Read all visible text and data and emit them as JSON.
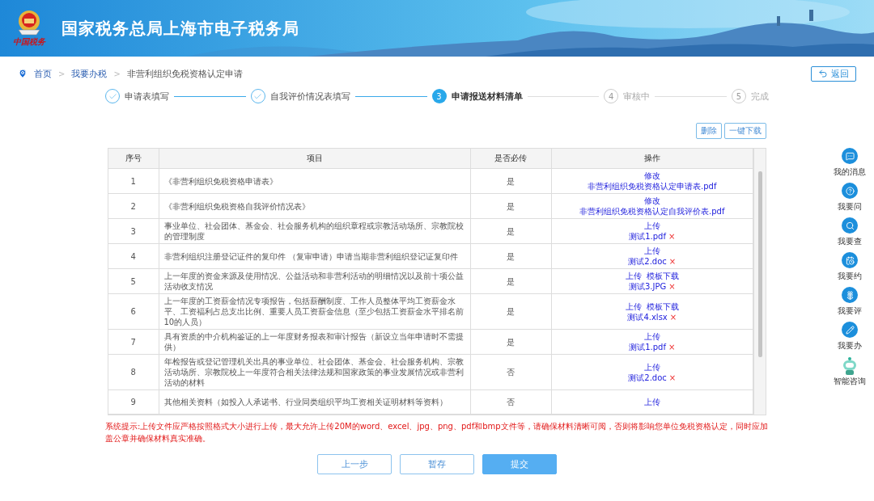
{
  "header": {
    "title": "国家税务总局上海市电子税务局",
    "logo_text": "中国税务"
  },
  "breadcrumb": [
    {
      "label": "首页",
      "kind": "link"
    },
    {
      "label": "我要办税",
      "kind": "link"
    },
    {
      "label": "非营利组织免税资格认定申请",
      "kind": "current"
    }
  ],
  "breadcrumb_separator": ">",
  "back_button": "返回",
  "steps": [
    {
      "label": "申请表填写",
      "completed": true,
      "selected": false
    },
    {
      "label": "自我评价情况表填写",
      "completed": true,
      "selected": false
    },
    {
      "number": "3",
      "label": "申请报送材料清单",
      "completed": false,
      "selected": true
    },
    {
      "number": "4",
      "label": "审核中",
      "completed": false,
      "selected": false
    },
    {
      "number": "5",
      "label": "完成",
      "completed": false,
      "selected": false
    }
  ],
  "toolbar": [
    "删除",
    "一键下载"
  ],
  "table": {
    "columns": [
      "序号",
      "项目",
      "是否必传",
      "操作"
    ],
    "rows": [
      {
        "seq": "1",
        "item": "《非营利组织免税资格申请表》",
        "required": "是",
        "actions": [
          "修改"
        ],
        "file": {
          "name": "非营利组织免税资格认定申请表.pdf"
        }
      },
      {
        "seq": "2",
        "item": "《非营利组织免税资格自我评价情况表》",
        "required": "是",
        "actions": [
          "修改"
        ],
        "file": {
          "name": "非营利组织免税资格认定自我评价表.pdf"
        }
      },
      {
        "seq": "3",
        "item": "事业单位、社会团体、基金会、社会服务机构的组织章程或宗教活动场所、宗教院校的管理制度",
        "required": "是",
        "actions": [
          "上传"
        ],
        "file": {
          "name": "测试1.pdf",
          "remove": "×"
        }
      },
      {
        "seq": "4",
        "item": "非营利组织注册登记证件的复印件 （复审申请）申请当期非营利组织登记证复印件",
        "required": "是",
        "actions": [
          "上传"
        ],
        "file": {
          "name": "测试2.doc",
          "remove": "×"
        }
      },
      {
        "seq": "5",
        "item": "上一年度的资金来源及使用情况、公益活动和非营利活动的明细情况以及前十项公益活动收支情况",
        "required": "是",
        "actions": [
          "上传",
          "模板下载"
        ],
        "file": {
          "name": "测试3.JPG",
          "remove": "×"
        }
      },
      {
        "seq": "6",
        "item": "上一年度的工资薪金情况专项报告，包括薪酬制度、工作人员整体平均工资薪金水平、工资福利占总支出比例、重要人员工资薪金信息（至少包括工资薪金水平排名前10的人员）",
        "required": "是",
        "actions": [
          "上传",
          "模板下载"
        ],
        "file": {
          "name": "测试4.xlsx",
          "remove": "×"
        }
      },
      {
        "seq": "7",
        "item": "具有资质的中介机构鉴证的上一年度财务报表和审计报告（新设立当年申请时不需提供）",
        "required": "是",
        "actions": [
          "上传"
        ],
        "file": {
          "name": "测试1.pdf",
          "remove": "×"
        }
      },
      {
        "seq": "8",
        "item": "年检报告或登记管理机关出具的事业单位、社会团体、基金会、社会服务机构、宗教活动场所、宗教院校上一年度符合相关法律法规和国家政策的事业发展情况或非营利活动的材料",
        "required": "否",
        "actions": [
          "上传"
        ],
        "file": {
          "name": "测试2.doc",
          "remove": "×"
        }
      },
      {
        "seq": "9",
        "item": "其他相关资料（如投入人承诺书、行业同类组织平均工资相关证明材料等资料）",
        "required": "否",
        "actions": [
          "上传"
        ]
      }
    ]
  },
  "notice": "系统提示:上传文件应严格按照格式大小进行上传，最大允许上传20M的word、excel、jpg、png、pdf和bmp文件等，请确保材料清晰可阅，否则将影响您单位免税资格认定，同时应加盖公章并确保材料真实准确。",
  "footer_buttons": [
    {
      "label": "上一步",
      "primary": false
    },
    {
      "label": "暂存",
      "primary": false
    },
    {
      "label": "提交",
      "primary": true
    }
  ],
  "side_nav": [
    {
      "label": "我的消息"
    },
    {
      "label": "我要问"
    },
    {
      "label": "我要查"
    },
    {
      "label": "我要约"
    },
    {
      "label": "我要评"
    },
    {
      "label": "我要办"
    }
  ],
  "assistant": {
    "label": "智能咨询"
  }
}
